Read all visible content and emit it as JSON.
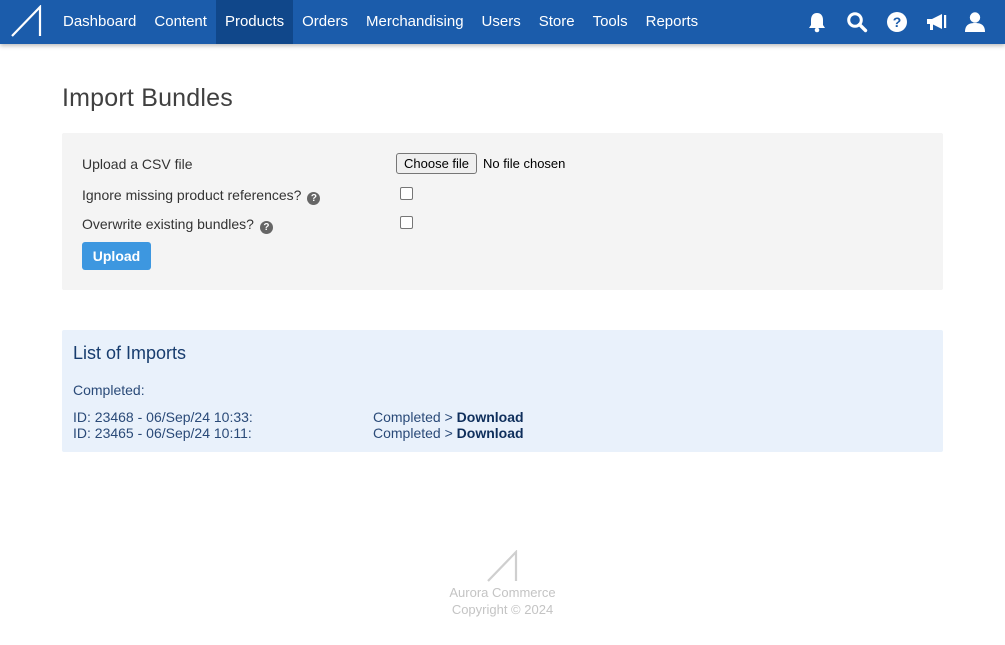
{
  "nav": {
    "logo_icon": "aurora-logo-icon",
    "items": [
      {
        "label": "Dashboard",
        "active": false
      },
      {
        "label": "Content",
        "active": false
      },
      {
        "label": "Products",
        "active": true
      },
      {
        "label": "Orders",
        "active": false
      },
      {
        "label": "Merchandising",
        "active": false
      },
      {
        "label": "Users",
        "active": false
      },
      {
        "label": "Store",
        "active": false
      },
      {
        "label": "Tools",
        "active": false
      },
      {
        "label": "Reports",
        "active": false
      }
    ],
    "icons": [
      "bell-icon",
      "search-icon",
      "help-icon",
      "megaphone-icon",
      "user-icon"
    ],
    "bg_color": "#1b5cab",
    "active_color": "#10478a"
  },
  "page": {
    "title": "Import Bundles"
  },
  "upload_form": {
    "csv_label": "Upload a CSV file",
    "file_button_label": "Choose file",
    "file_status": "No file chosen",
    "ignore_missing_label": "Ignore missing product references?",
    "ignore_missing_checked": false,
    "overwrite_label": "Overwrite existing bundles?",
    "overwrite_checked": false,
    "help_glyph": "?",
    "upload_button_label": "Upload",
    "upload_button_color": "#3d97e0"
  },
  "imports": {
    "title": "List of Imports",
    "completed_label": "Completed:",
    "rows": [
      {
        "id_text": "ID: 23468 - 06/Sep/24 10:33:",
        "status_text": "Completed >",
        "link_text": "Download"
      },
      {
        "id_text": "ID: 23465 - 06/Sep/24 10:11:",
        "status_text": "Completed >",
        "link_text": "Download"
      }
    ],
    "panel_color": "#e9f1fb"
  },
  "footer": {
    "company": "Aurora Commerce",
    "copyright": "Copyright © 2024"
  }
}
